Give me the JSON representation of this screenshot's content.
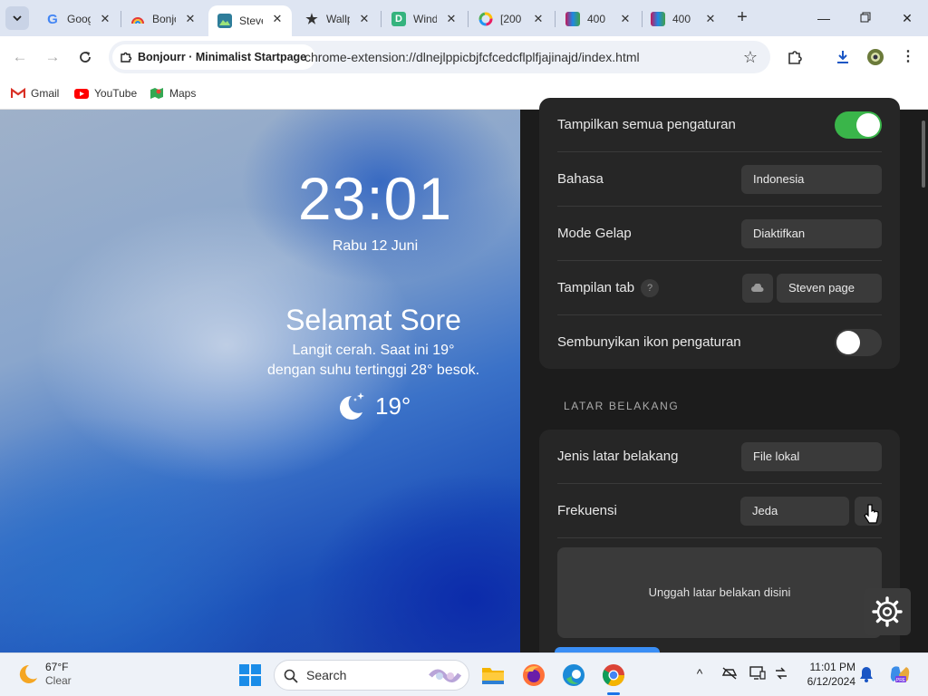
{
  "browser": {
    "tabs": [
      {
        "label": "Google",
        "favicon": "google-icon",
        "active": false
      },
      {
        "label": "Bonjourr",
        "favicon": "rainbow-icon",
        "active": false
      },
      {
        "label": "Steven",
        "favicon": "steven-icon",
        "active": true
      },
      {
        "label": "Wallpaper",
        "favicon": "star-icon",
        "active": false
      },
      {
        "label": "Windows",
        "favicon": "d-icon",
        "active": false
      },
      {
        "label": "[200",
        "favicon": "ring-icon",
        "active": false
      },
      {
        "label": "400",
        "favicon": "image-icon",
        "active": false
      },
      {
        "label": "400",
        "favicon": "image-icon",
        "active": false
      }
    ],
    "site_chip": "Bonjourr · Minimalist Startpage",
    "url": "chrome-extension://dlnejlppicbjfcfcedcflplfjajinajd/index.html",
    "bookmarks": [
      {
        "label": "Gmail",
        "icon": "gmail-icon"
      },
      {
        "label": "YouTube",
        "icon": "youtube-icon"
      },
      {
        "label": "Maps",
        "icon": "maps-icon"
      }
    ]
  },
  "startpage": {
    "clock": "23:01",
    "date": "Rabu 12 Juni",
    "greeting": "Selamat Sore",
    "description_line1": "Langit cerah. Saat ini 19°",
    "description_line2": "dengan suhu tertinggi 28° besok.",
    "temperature": "19°",
    "weather_icon": "moon-stars-icon"
  },
  "settings": {
    "show_all_label": "Tampilkan semua pengaturan",
    "show_all_on": true,
    "language_label": "Bahasa",
    "language_value": "Indonesia",
    "dark_mode_label": "Mode Gelap",
    "dark_mode_value": "Diaktifkan",
    "tab_display_label": "Tampilan tab",
    "tab_display_help": "?",
    "tab_display_value": "Steven page",
    "hide_icon_label": "Sembunyikan ikon pengaturan",
    "hide_icon_on": false,
    "background_section": "LATAR BELAKANG",
    "bg_type_label": "Jenis latar belakang",
    "bg_type_value": "File lokal",
    "frequency_label": "Frekuensi",
    "frequency_value": "Jeda",
    "upload_text": "Unggah latar belakan disini",
    "accent_color": "#3ab54a"
  },
  "taskbar": {
    "weather_temp": "67°F",
    "weather_desc": "Clear",
    "search_placeholder": "Search",
    "time": "11:01 PM",
    "date": "6/12/2024"
  }
}
